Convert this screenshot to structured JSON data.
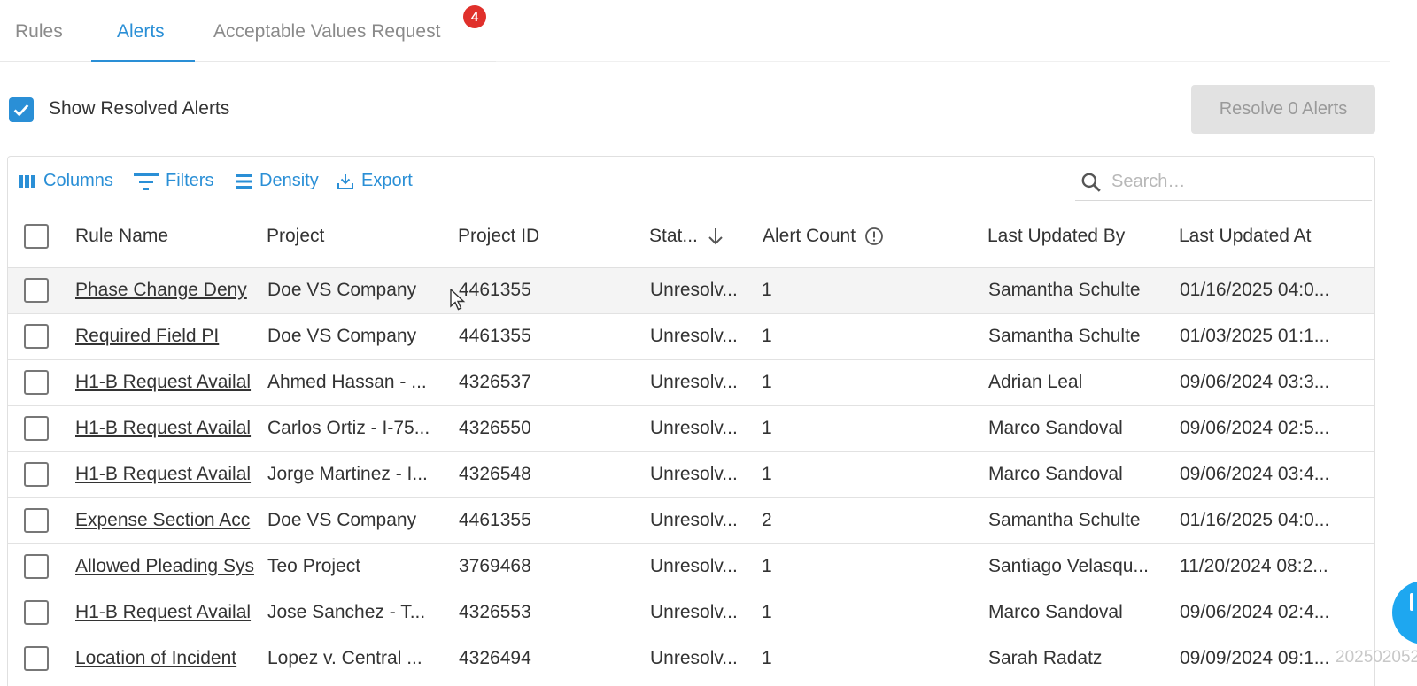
{
  "tabs": [
    {
      "label": "Rules"
    },
    {
      "label": "Alerts"
    },
    {
      "label": "Acceptable Values Request"
    }
  ],
  "tab_badge": "4",
  "show_resolved": {
    "label": "Show Resolved Alerts",
    "checked": true
  },
  "resolve_button": "Resolve 0 Alerts",
  "toolbar": {
    "columns": "Columns",
    "filters": "Filters",
    "density": "Density",
    "export": "Export",
    "search_placeholder": "Search…"
  },
  "columns": {
    "rule_name": "Rule Name",
    "project": "Project",
    "project_id": "Project ID",
    "status": "Stat...",
    "alert_count": "Alert Count",
    "last_updated_by": "Last Updated By",
    "last_updated_at": "Last Updated At"
  },
  "rows": [
    {
      "rule_name": "Phase Change Deny",
      "project": "Doe VS Company",
      "project_id": "4461355",
      "status": "Unresolv...",
      "alert_count": "1",
      "last_updated_by": "Samantha Schulte",
      "last_updated_at": "01/16/2025 04:0..."
    },
    {
      "rule_name": "Required Field PI",
      "project": "Doe VS Company",
      "project_id": "4461355",
      "status": "Unresolv...",
      "alert_count": "1",
      "last_updated_by": "Samantha Schulte",
      "last_updated_at": "01/03/2025 01:1..."
    },
    {
      "rule_name": "H1-B Request Availal",
      "project": "Ahmed Hassan - ...",
      "project_id": "4326537",
      "status": "Unresolv...",
      "alert_count": "1",
      "last_updated_by": "Adrian Leal",
      "last_updated_at": "09/06/2024 03:3..."
    },
    {
      "rule_name": "H1-B Request Availal",
      "project": "Carlos Ortiz - I-75...",
      "project_id": "4326550",
      "status": "Unresolv...",
      "alert_count": "1",
      "last_updated_by": "Marco Sandoval",
      "last_updated_at": "09/06/2024 02:5..."
    },
    {
      "rule_name": "H1-B Request Availal",
      "project": "Jorge Martinez - I...",
      "project_id": "4326548",
      "status": "Unresolv...",
      "alert_count": "1",
      "last_updated_by": "Marco Sandoval",
      "last_updated_at": "09/06/2024 03:4..."
    },
    {
      "rule_name": "Expense Section Acc",
      "project": "Doe VS Company",
      "project_id": "4461355",
      "status": "Unresolv...",
      "alert_count": "2",
      "last_updated_by": "Samantha Schulte",
      "last_updated_at": "01/16/2025 04:0..."
    },
    {
      "rule_name": "Allowed Pleading Sys",
      "project": "Teo Project",
      "project_id": "3769468",
      "status": "Unresolv...",
      "alert_count": "1",
      "last_updated_by": "Santiago Velasqu...",
      "last_updated_at": "11/20/2024 08:2..."
    },
    {
      "rule_name": "H1-B Request Availal",
      "project": "Jose Sanchez - T...",
      "project_id": "4326553",
      "status": "Unresolv...",
      "alert_count": "1",
      "last_updated_by": "Marco Sandoval",
      "last_updated_at": "09/06/2024 02:4..."
    },
    {
      "rule_name": "Location of Incident",
      "project": "Lopez v. Central ...",
      "project_id": "4326494",
      "status": "Unresolv...",
      "alert_count": "1",
      "last_updated_by": "Sarah Radatz",
      "last_updated_at": "09/09/2024 09:1..."
    }
  ],
  "watermark": "202502052",
  "colors": {
    "accent": "#2a8fd6",
    "badge": "#e0302b",
    "disabled_bg": "#e2e2e2"
  }
}
